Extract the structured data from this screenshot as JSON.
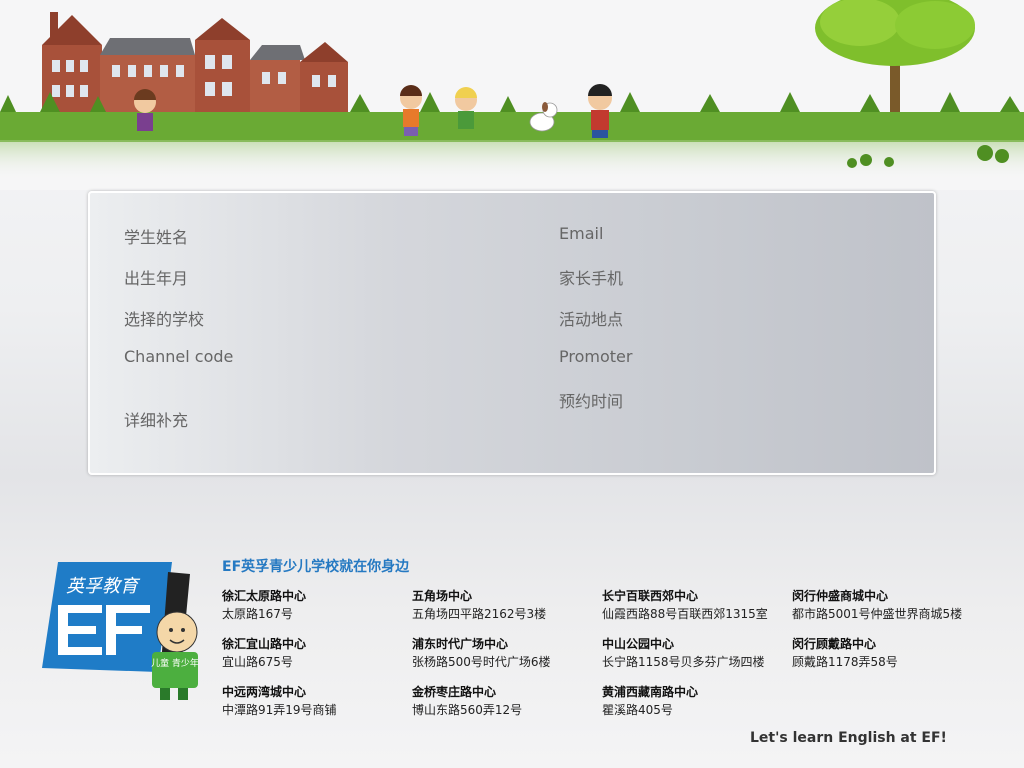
{
  "form": {
    "left_fields": [
      {
        "label": "学生姓名"
      },
      {
        "label": "出生年月"
      },
      {
        "label": "选择的学校"
      },
      {
        "label": "Channel code"
      },
      {
        "label": "详细补充"
      }
    ],
    "right_fields": [
      {
        "label": "Email"
      },
      {
        "label": "家长手机"
      },
      {
        "label": "活动地点"
      },
      {
        "label": "Promoter"
      },
      {
        "label": "预约时间"
      }
    ]
  },
  "footer": {
    "title": "EF英孚青少儿学校就在你身边",
    "slogan": "Let's learn English at EF!",
    "logo": {
      "brand_text": "英孚教育",
      "mascot_text": "儿童 青少年",
      "brand_color": "#1f7cc7"
    },
    "centers": [
      {
        "name": "徐汇太原路中心",
        "address": "太原路167号"
      },
      {
        "name": "五角场中心",
        "address": "五角场四平路2162号3楼"
      },
      {
        "name": "长宁百联西郊中心",
        "address": "仙霞西路88号百联西郊1315室"
      },
      {
        "name": "闵行仲盛商城中心",
        "address": "都市路5001号仲盛世界商城5楼"
      },
      {
        "name": "徐汇宜山路中心",
        "address": "宜山路675号"
      },
      {
        "name": "浦东时代广场中心",
        "address": "张杨路500号时代广场6楼"
      },
      {
        "name": "中山公园中心",
        "address": "长宁路1158号贝多芬广场四楼"
      },
      {
        "name": "闵行顾戴路中心",
        "address": "顾戴路1178弄58号"
      },
      {
        "name": "中远两湾城中心",
        "address": "中潭路91弄19号商铺"
      },
      {
        "name": "金桥枣庄路中心",
        "address": "博山东路560弄12号"
      },
      {
        "name": "黄浦西藏南路中心",
        "address": "瞿溪路405号"
      }
    ]
  },
  "colors": {
    "accent": "#2579c2",
    "grass": "#6aaa34",
    "brick": "#a8513a"
  }
}
